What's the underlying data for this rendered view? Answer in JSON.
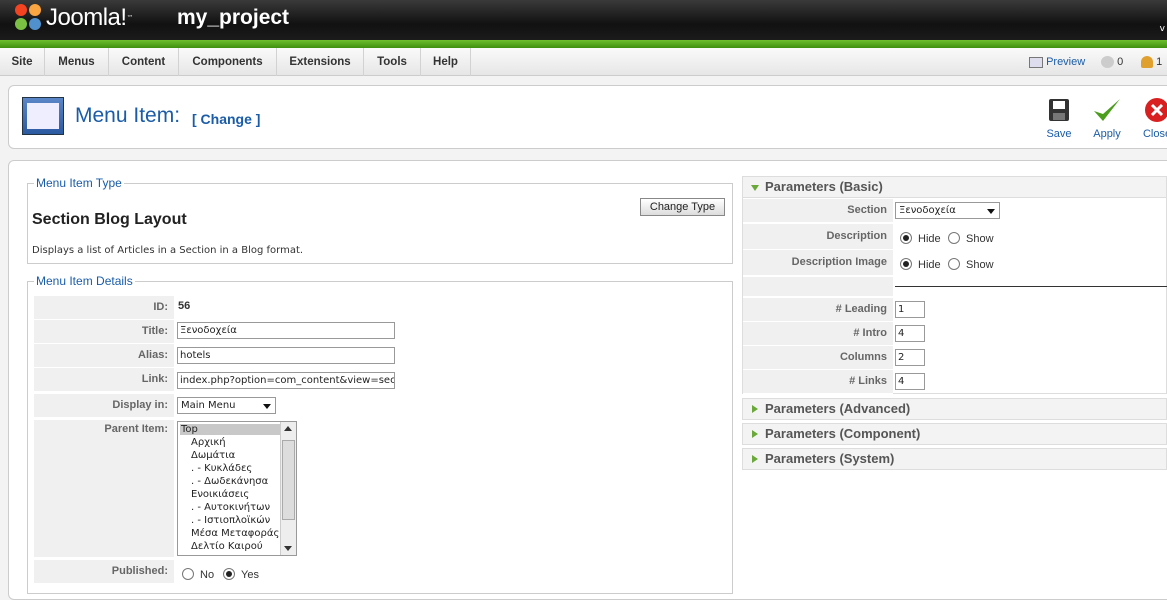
{
  "header": {
    "logo_text": "Joomla!",
    "logo_tm": "™",
    "project": "my_project",
    "corner": "v"
  },
  "menu": [
    "Site",
    "Menus",
    "Content",
    "Components",
    "Extensions",
    "Tools",
    "Help"
  ],
  "status": {
    "preview": "Preview",
    "messages": "0",
    "users": "1"
  },
  "toolbar": {
    "title": "Menu Item:",
    "change": "[ Change ]",
    "save": "Save",
    "apply": "Apply",
    "close": "Close"
  },
  "type": {
    "legend": "Menu Item Type",
    "title": "Section Blog Layout",
    "description": "Displays a list of Articles in a Section in a Blog format.",
    "change_button": "Change Type"
  },
  "details": {
    "legend": "Menu Item Details",
    "id_label": "ID:",
    "id_value": "56",
    "title_label": "Title:",
    "title_value": "Ξενοδοχεία",
    "alias_label": "Alias:",
    "alias_value": "hotels",
    "link_label": "Link:",
    "link_value": "index.php?option=com_content&view=section",
    "display_label": "Display in:",
    "display_value": "Main Menu",
    "parent_label": "Parent Item:",
    "parent_options": [
      "Top",
      "Αρχική",
      "Δωμάτια",
      ".  - Κυκλάδες",
      ".  - Δωδεκάνησα",
      "Ενοικιάσεις",
      ".  - Αυτοκινήτων",
      ".  - Ιστιοπλοϊκών",
      "Μέσα Μεταφοράς",
      "Δελτίο Καιρού"
    ],
    "published_label": "Published:",
    "published_no": "No",
    "published_yes": "Yes"
  },
  "params_basic": {
    "title": "Parameters (Basic)",
    "section_label": "Section",
    "section_value": "Ξενοδοχεία",
    "description_label": "Description",
    "description_image_label": "Description Image",
    "hide": "Hide",
    "show": "Show",
    "leading_label": "# Leading",
    "leading_value": "1",
    "intro_label": "# Intro",
    "intro_value": "4",
    "columns_label": "Columns",
    "columns_value": "2",
    "links_label": "# Links",
    "links_value": "4"
  },
  "params_other": [
    "Parameters (Advanced)",
    "Parameters (Component)",
    "Parameters (System)"
  ]
}
